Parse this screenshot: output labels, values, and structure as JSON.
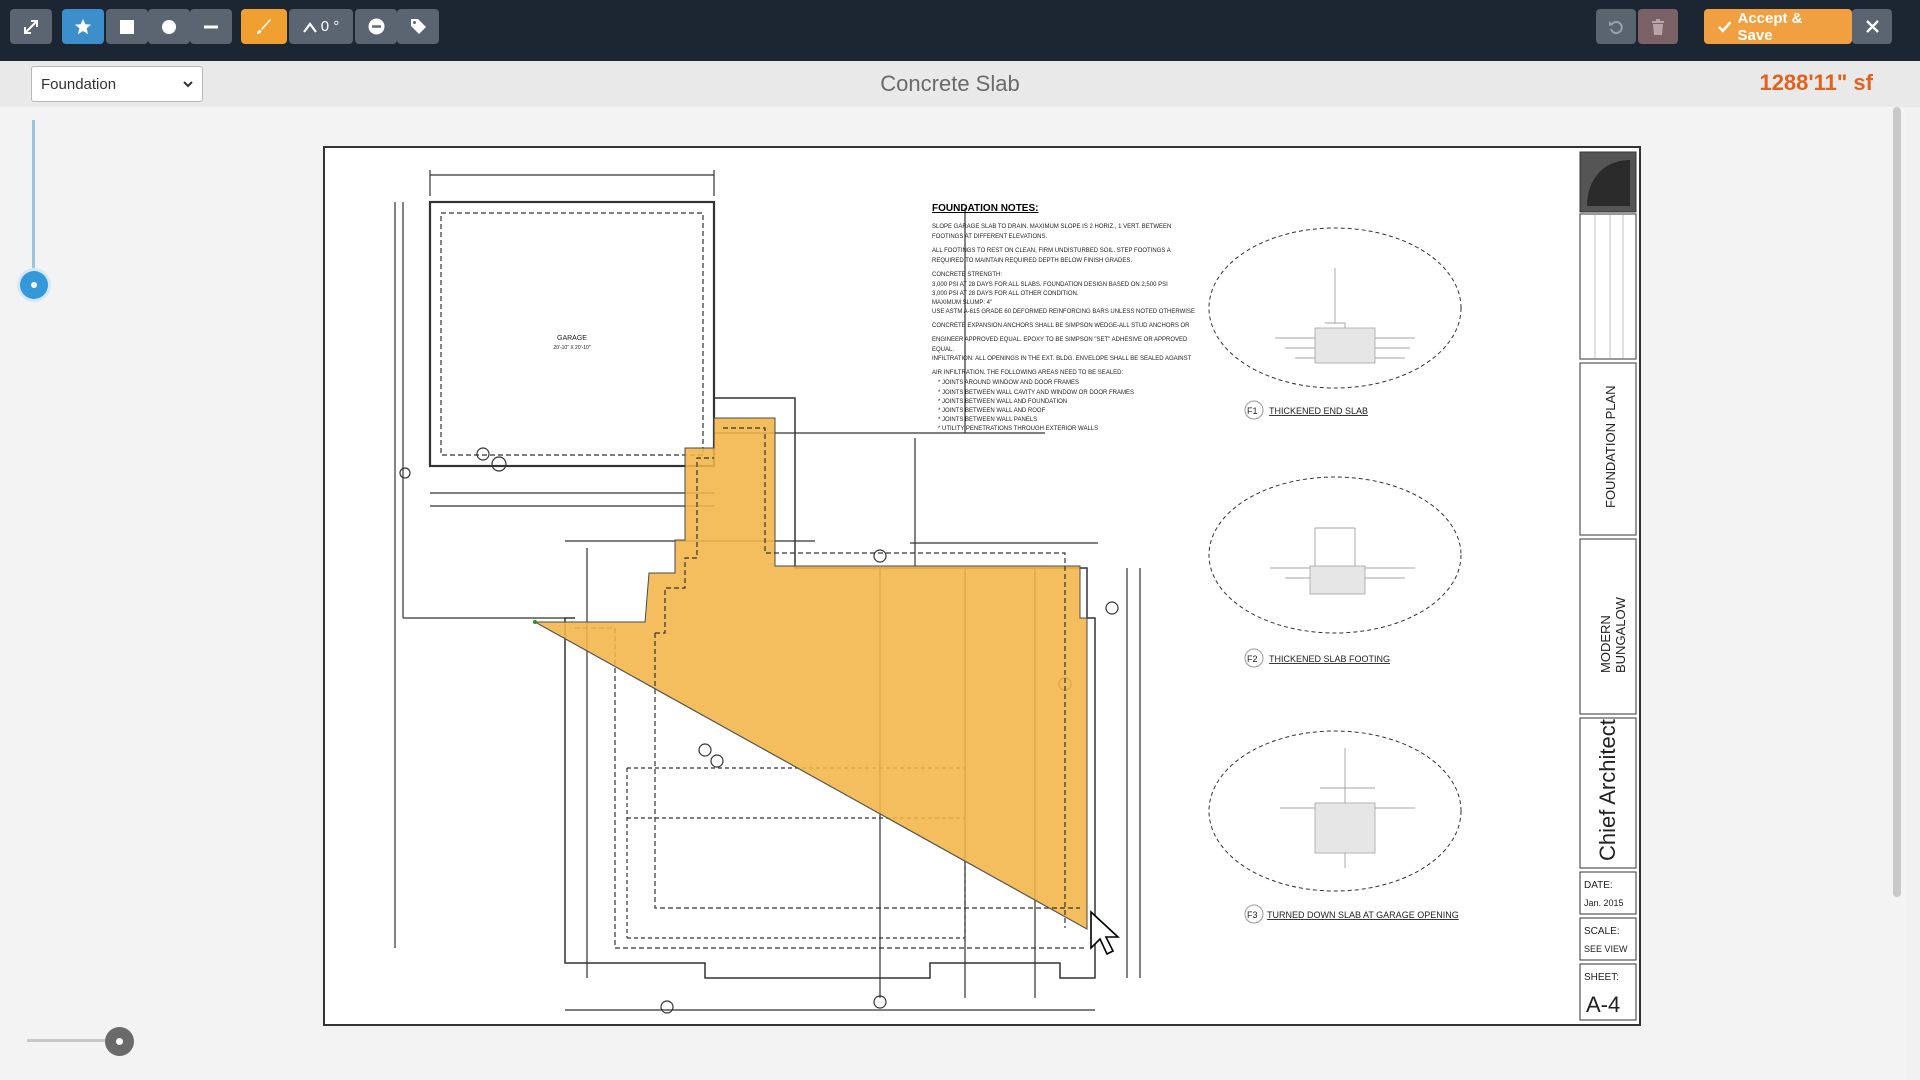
{
  "toolbar": {
    "angle_label": "0 °",
    "accept_label": "Accept & Save"
  },
  "header": {
    "floor_select_value": "Foundation",
    "title": "Concrete Slab",
    "area": "1288'11\" sf"
  },
  "drawing": {
    "room_label": "GARAGE",
    "room_size": "20'-10\" X 20'-10\"",
    "notes_title": "FOUNDATION NOTES:",
    "notes": [
      "SLOPE GARAGE SLAB TO DRAIN. MAXIMUM SLOPE IS 2 HORIZ., 1 VERT. BETWEEN",
      "FOOTINGS AT DIFFERENT ELEVATIONS.",
      "ALL FOOTINGS TO REST ON CLEAN, FIRM UNDISTURBED SOIL. STEP FOOTINGS A",
      "REQUIRED TO MAINTAIN REQUIRED DEPTH BELOW FINISH GRADES.",
      "CONCRETE STRENGTH:",
      "3,000 PSI AT 28 DAYS FOR ALL SLABS. FOUNDATION DESIGN BASED ON 2,500 PSI",
      "3,000 PSI AT 28 DAYS FOR ALL OTHER CONDITION.",
      "MAXIMUM SLUMP: 4\"",
      "USE ASTM A-615 GRADE 60 DEFORMED REINFORCING BARS UNLESS NOTED OTHERWISE",
      "CONCRETE EXPANSION ANCHORS SHALL BE SIMPSON WEDGE-ALL STUD ANCHORS OR",
      "ENGINEER APPROVED EQUAL. EPOXY TO BE SIMPSON \"SET\" ADHESIVE OR APPROVED",
      "EQUAL.",
      "INFILTRATION: ALL OPENINGS IN THE EXT. BLDG. ENVELOPE SHALL BE SEALED AGAINST",
      "AIR INFILTRATION. THE FOLLOWING AREAS NEED TO BE SEALED:",
      "* JOINTS AROUND WINDOW AND DOOR FRAMES",
      "* JOINTS BETWEEN WALL CAVITY AND WINDOW OR DOOR FRAMES",
      "* JOINTS BETWEEN WALL AND FOUNDATION",
      "* JOINTS BETWEEN WALL AND ROOF",
      "* JOINTS BETWEEN WALL PANELS",
      "* UTILITY PENETRATIONS THROUGH EXTERIOR WALLS"
    ],
    "details": [
      {
        "num": "F1",
        "label": "THICKENED END SLAB"
      },
      {
        "num": "F2",
        "label": "THICKENED SLAB FOOTING"
      },
      {
        "num": "F3",
        "label": "TURNED DOWN SLAB AT GARAGE OPENING"
      }
    ],
    "title_block": {
      "sheet_title": "FOUNDATION PLAN",
      "project_line1": "MODERN",
      "project_line2": "BUNGALOW",
      "firm": "Chief Architect",
      "date_label": "DATE:",
      "date_value": "Jan. 2015",
      "scale_label": "SCALE:",
      "scale_value": "SEE VIEW",
      "sheet_label": "SHEET:",
      "sheet_value": "A-4"
    }
  },
  "colors": {
    "toolbar_bg": "#1c2632",
    "accent_blue": "#3d8fcc",
    "accent_orange": "#f0a030",
    "slab_fill": "#f2b548",
    "area_text": "#e0621e"
  }
}
